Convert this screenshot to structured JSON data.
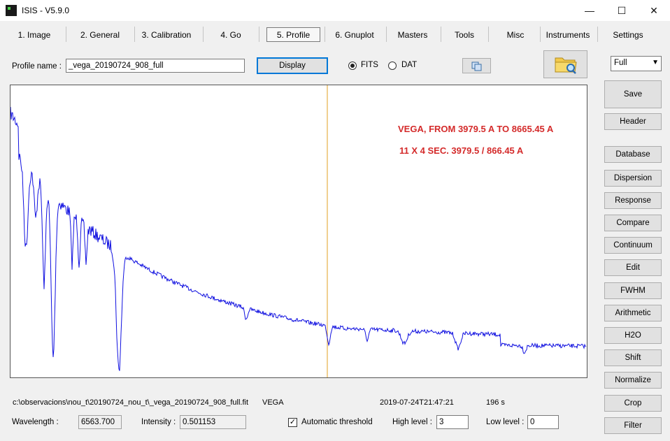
{
  "window": {
    "title": "ISIS - V5.9.0",
    "minimize": "—",
    "maximize": "☐",
    "close": "✕"
  },
  "tabs": [
    "1. Image",
    "2. General",
    "3. Calibration",
    "4. Go",
    "5. Profile",
    "6. Gnuplot",
    "Masters",
    "Tools",
    "Misc",
    "Instruments",
    "Settings"
  ],
  "active_tab": "5. Profile",
  "profile": {
    "label": "Profile name :",
    "value": "_vega_20190724_908_full",
    "display_button": "Display",
    "fits_label": "FITS",
    "dat_label": "DAT",
    "selected_format": "FITS"
  },
  "view_combo": {
    "value": "Full"
  },
  "plot": {
    "annotation_line1": "VEGA,  FROM 3979.5 A TO 8665.45 A",
    "annotation_line2": "11 X 4 SEC.   3979.5 / 866.45 A",
    "trace_color": "#1010e0",
    "cursor_color": "#e0a020",
    "cursor_fraction": 0.55
  },
  "side_buttons": [
    "Save",
    "Header",
    "Database",
    "Dispersion",
    "Response",
    "Compare",
    "Continuum",
    "Edit",
    "FWHM",
    "Arithmetic",
    "H2O",
    "Shift",
    "Normalize",
    "Crop",
    "Filter"
  ],
  "status": {
    "path": "c:\\observacions\\nou_t\\20190724_nou_t\\_vega_20190724_908_full.fit",
    "object": "VEGA",
    "datetime": "2019-07-24T21:47:21",
    "exposure": "196 s"
  },
  "readout": {
    "wavelength_label": "Wavelength :",
    "wavelength_value": "6563.700",
    "intensity_label": "Intensity :",
    "intensity_value": "0.501153",
    "auto_threshold_label": "Automatic threshold",
    "auto_threshold_checked": true,
    "high_level_label": "High level :",
    "high_level_value": "3",
    "low_level_label": "Low level :",
    "low_level_value": "0"
  }
}
